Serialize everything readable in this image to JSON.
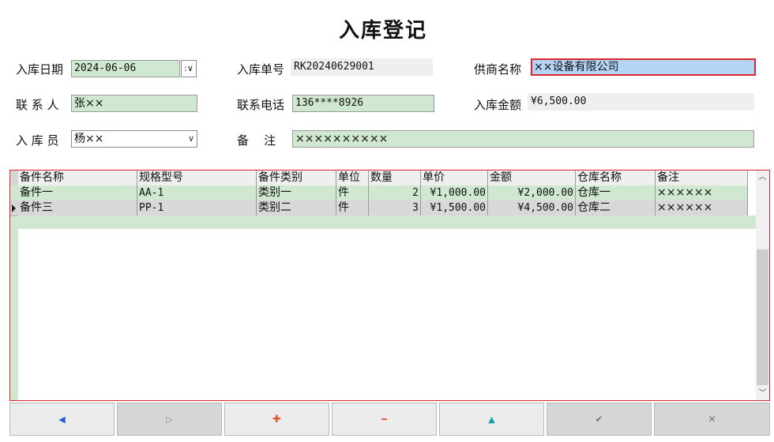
{
  "title": "入库登记",
  "form": {
    "date_label": "入库日期",
    "date_value": "2024-06-06",
    "date_btn": ":∨",
    "order_label": "入库单号",
    "order_value": "RK20240629001",
    "supplier_label": "供商名称",
    "supplier_value": "××设备有限公司",
    "contact_label": "联 系 人",
    "contact_value": "张××",
    "phone_label": "联系电话",
    "phone_value": "136****8926",
    "amount_label": "入库金额",
    "amount_value": "¥6,500.00",
    "clerk_label": "入 库 员",
    "clerk_value": "杨××",
    "note_label": "备    注",
    "note_value": "××××××××××"
  },
  "table": {
    "columns": [
      "备件名称",
      "规格型号",
      "备件类别",
      "单位",
      "数量",
      "单价",
      "金额",
      "仓库名称",
      "备注"
    ],
    "rows": [
      [
        "备件一",
        "AA-1",
        "类别一",
        "件",
        "2",
        "¥1,000.00",
        "¥2,000.00",
        "仓库一",
        "××××××"
      ],
      [
        "备件三",
        "PP-1",
        "类别二",
        "件",
        "3",
        "¥1,500.00",
        "¥4,500.00",
        "仓库二",
        "××××××"
      ]
    ]
  },
  "toolbar": {
    "prev": "◀",
    "next": "▷",
    "add": "✚",
    "remove": "━",
    "up": "▲",
    "save": "✔",
    "cancel": "✕"
  },
  "colors": {
    "field_green": "#cfe8cf",
    "field_gray": "#efefef",
    "highlight_blue": "#b4d4f6",
    "focus_red": "#d9262b",
    "icon_blue": "#1f5fd8",
    "icon_orange": "#e0552a",
    "icon_teal": "#1aa0b0"
  }
}
